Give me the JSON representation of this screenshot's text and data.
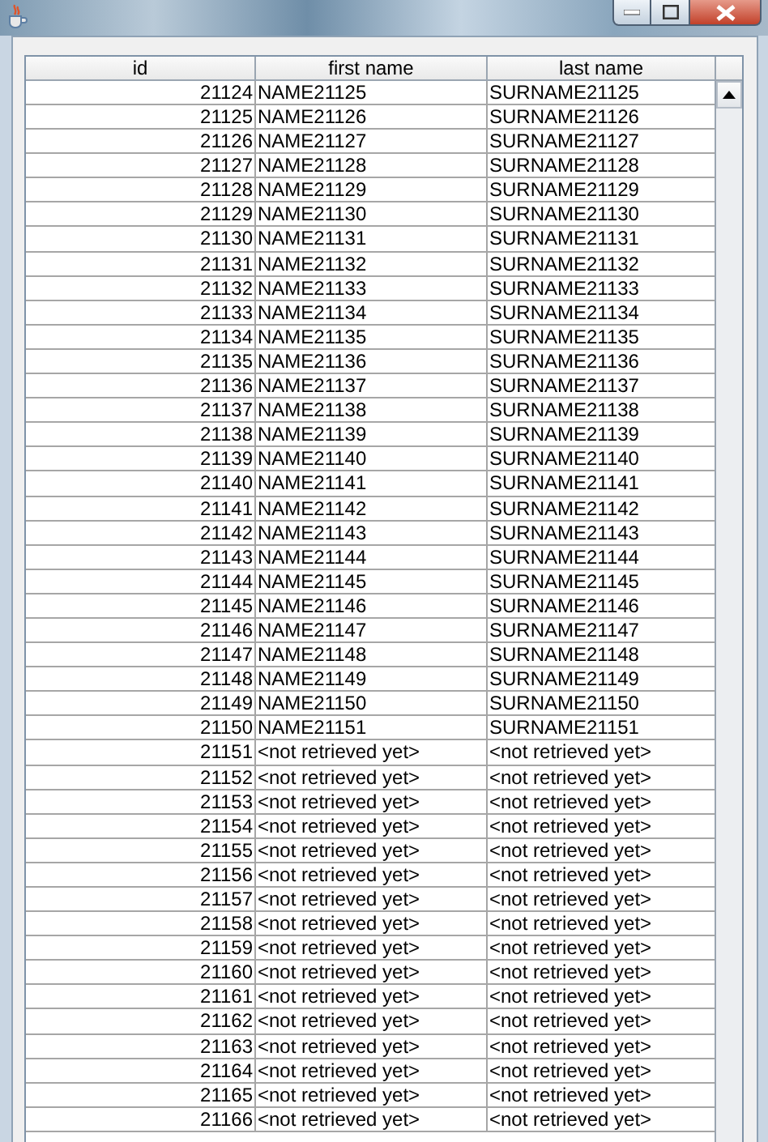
{
  "table": {
    "columns": [
      "id",
      "first name",
      "last name"
    ],
    "rows": [
      [
        "21124",
        "NAME21125",
        "SURNAME21125"
      ],
      [
        "21125",
        "NAME21126",
        "SURNAME21126"
      ],
      [
        "21126",
        "NAME21127",
        "SURNAME21127"
      ],
      [
        "21127",
        "NAME21128",
        "SURNAME21128"
      ],
      [
        "21128",
        "NAME21129",
        "SURNAME21129"
      ],
      [
        "21129",
        "NAME21130",
        "SURNAME21130"
      ],
      [
        "21130",
        "NAME21131",
        "SURNAME21131"
      ],
      [
        "21131",
        "NAME21132",
        "SURNAME21132"
      ],
      [
        "21132",
        "NAME21133",
        "SURNAME21133"
      ],
      [
        "21133",
        "NAME21134",
        "SURNAME21134"
      ],
      [
        "21134",
        "NAME21135",
        "SURNAME21135"
      ],
      [
        "21135",
        "NAME21136",
        "SURNAME21136"
      ],
      [
        "21136",
        "NAME21137",
        "SURNAME21137"
      ],
      [
        "21137",
        "NAME21138",
        "SURNAME21138"
      ],
      [
        "21138",
        "NAME21139",
        "SURNAME21139"
      ],
      [
        "21139",
        "NAME21140",
        "SURNAME21140"
      ],
      [
        "21140",
        "NAME21141",
        "SURNAME21141"
      ],
      [
        "21141",
        "NAME21142",
        "SURNAME21142"
      ],
      [
        "21142",
        "NAME21143",
        "SURNAME21143"
      ],
      [
        "21143",
        "NAME21144",
        "SURNAME21144"
      ],
      [
        "21144",
        "NAME21145",
        "SURNAME21145"
      ],
      [
        "21145",
        "NAME21146",
        "SURNAME21146"
      ],
      [
        "21146",
        "NAME21147",
        "SURNAME21147"
      ],
      [
        "21147",
        "NAME21148",
        "SURNAME21148"
      ],
      [
        "21148",
        "NAME21149",
        "SURNAME21149"
      ],
      [
        "21149",
        "NAME21150",
        "SURNAME21150"
      ],
      [
        "21150",
        "NAME21151",
        "SURNAME21151"
      ],
      [
        "21151",
        "<not retrieved yet>",
        "<not retrieved yet>"
      ],
      [
        "21152",
        "<not retrieved yet>",
        "<not retrieved yet>"
      ],
      [
        "21153",
        "<not retrieved yet>",
        "<not retrieved yet>"
      ],
      [
        "21154",
        "<not retrieved yet>",
        "<not retrieved yet>"
      ],
      [
        "21155",
        "<not retrieved yet>",
        "<not retrieved yet>"
      ],
      [
        "21156",
        "<not retrieved yet>",
        "<not retrieved yet>"
      ],
      [
        "21157",
        "<not retrieved yet>",
        "<not retrieved yet>"
      ],
      [
        "21158",
        "<not retrieved yet>",
        "<not retrieved yet>"
      ],
      [
        "21159",
        "<not retrieved yet>",
        "<not retrieved yet>"
      ],
      [
        "21160",
        "<not retrieved yet>",
        "<not retrieved yet>"
      ],
      [
        "21161",
        "<not retrieved yet>",
        "<not retrieved yet>"
      ],
      [
        "21162",
        "<not retrieved yet>",
        "<not retrieved yet>"
      ],
      [
        "21163",
        "<not retrieved yet>",
        "<not retrieved yet>"
      ],
      [
        "21164",
        "<not retrieved yet>",
        "<not retrieved yet>"
      ],
      [
        "21165",
        "<not retrieved yet>",
        "<not retrieved yet>"
      ],
      [
        "21166",
        "<not retrieved yet>",
        "<not retrieved yet>"
      ]
    ]
  }
}
